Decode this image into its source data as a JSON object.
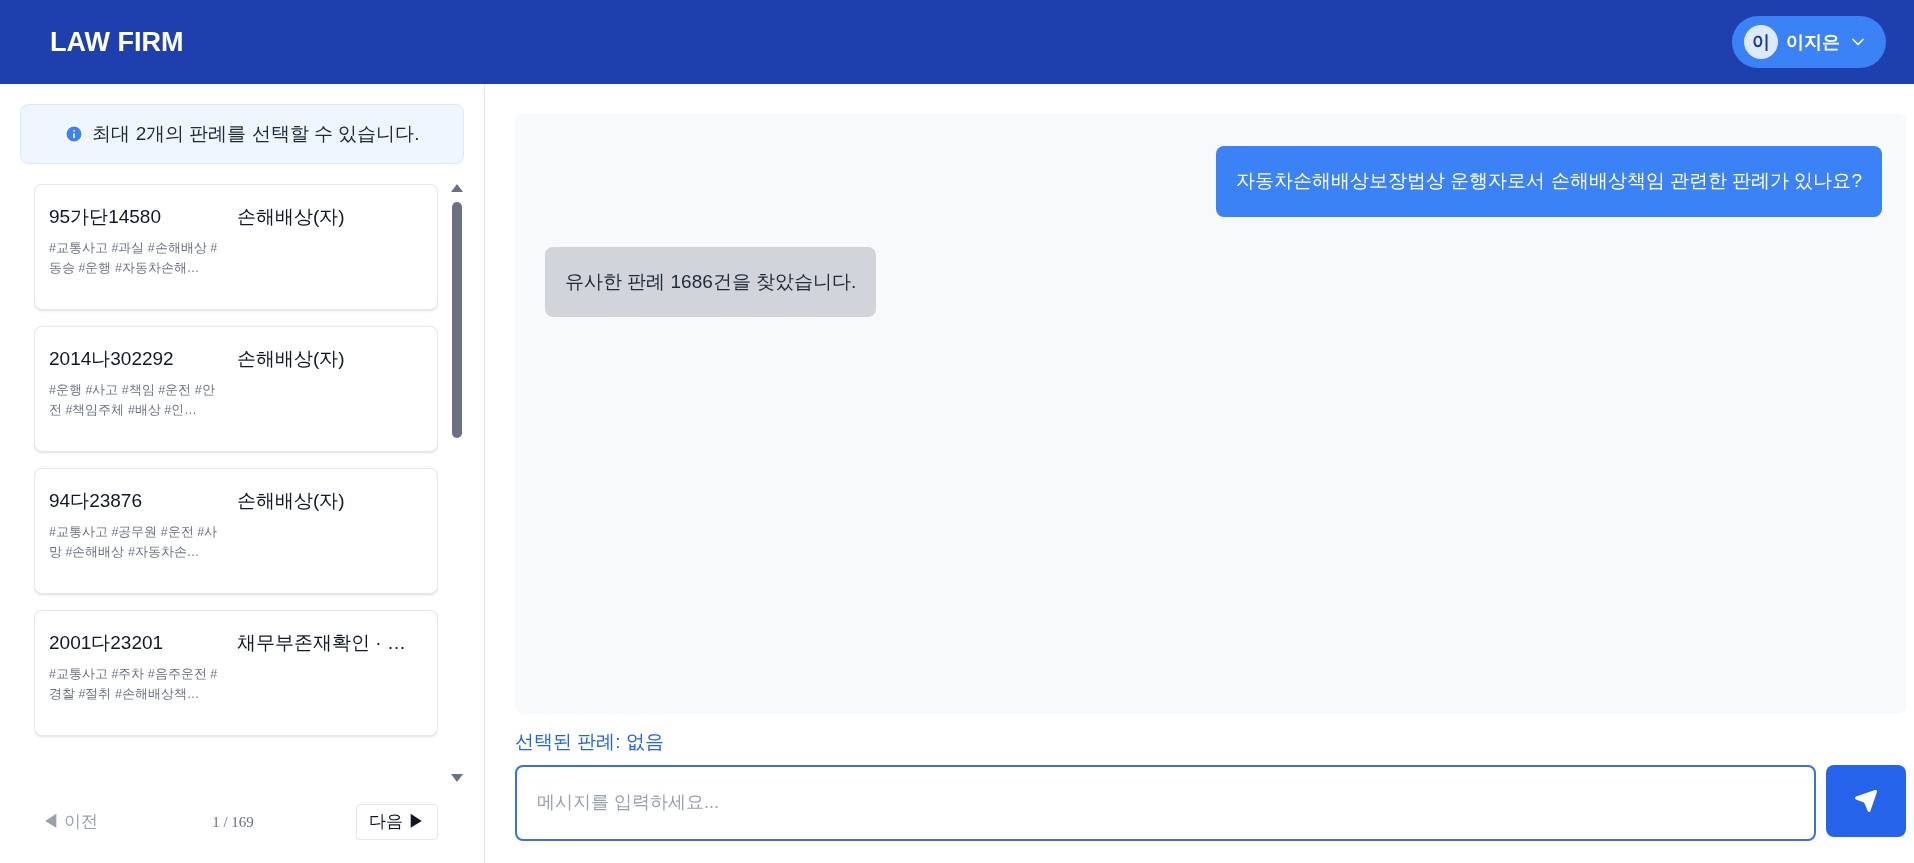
{
  "header": {
    "logo": "LAW FIRM",
    "user": {
      "initial": "이",
      "name": "이지은"
    }
  },
  "sidebar": {
    "notice": "최대 2개의 판례를 선택할 수 있습니다.",
    "cases": [
      {
        "number": "95가단14580",
        "title": "손해배상(자)",
        "tags": "#교통사고 #과실 #손해배상 #동승 #운행 #자동차손해…",
        "selected": false
      },
      {
        "number": "2014나302292",
        "title": "손해배상(자)",
        "tags": "#운행 #사고 #책임 #운전 #안전 #책임주체 #배상 #인…",
        "selected": false
      },
      {
        "number": "94다23876",
        "title": "손해배상(자)",
        "tags": "#교통사고 #공무원 #운전 #사망 #손해배상 #자동차손…",
        "selected": false
      },
      {
        "number": "2001다23201",
        "title": "채무부존재확인 · …",
        "tags": "#교통사고 #주차 #음주운전 #경찰 #절취 #손해배상책…",
        "selected": false
      }
    ],
    "pagination": {
      "prev": {
        "arrow": "◀",
        "label": "이전",
        "disabled": true
      },
      "page": "1 / 169",
      "next": {
        "label": "다음",
        "arrow": "▶",
        "disabled": false
      }
    }
  },
  "chat": {
    "messages": [
      {
        "kind": "user",
        "text": "자동차손해배상보장법상 운행자로서 손해배상책임 관련한 판례가 있나요?"
      },
      {
        "kind": "assistant",
        "text": "유사한 판례 1686건을 찾았습니다."
      }
    ],
    "selected_label": "선택된 판례: 없음",
    "input": {
      "placeholder": "메시지를 입력하세요..."
    }
  }
}
